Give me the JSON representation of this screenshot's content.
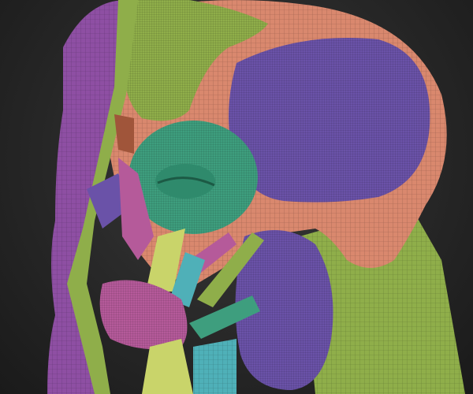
{
  "colors": {
    "background": "#2a2a2a",
    "skin": "#d9886e",
    "purple": "#8e4fa3",
    "violet": "#6a52a8",
    "green": "#8fae4a",
    "teal": "#3e9e7e",
    "lime": "#c9d46a",
    "pink": "#b55a9a",
    "cyan": "#4fb0b8",
    "brown": "#a0553a",
    "wire": "#000000"
  }
}
